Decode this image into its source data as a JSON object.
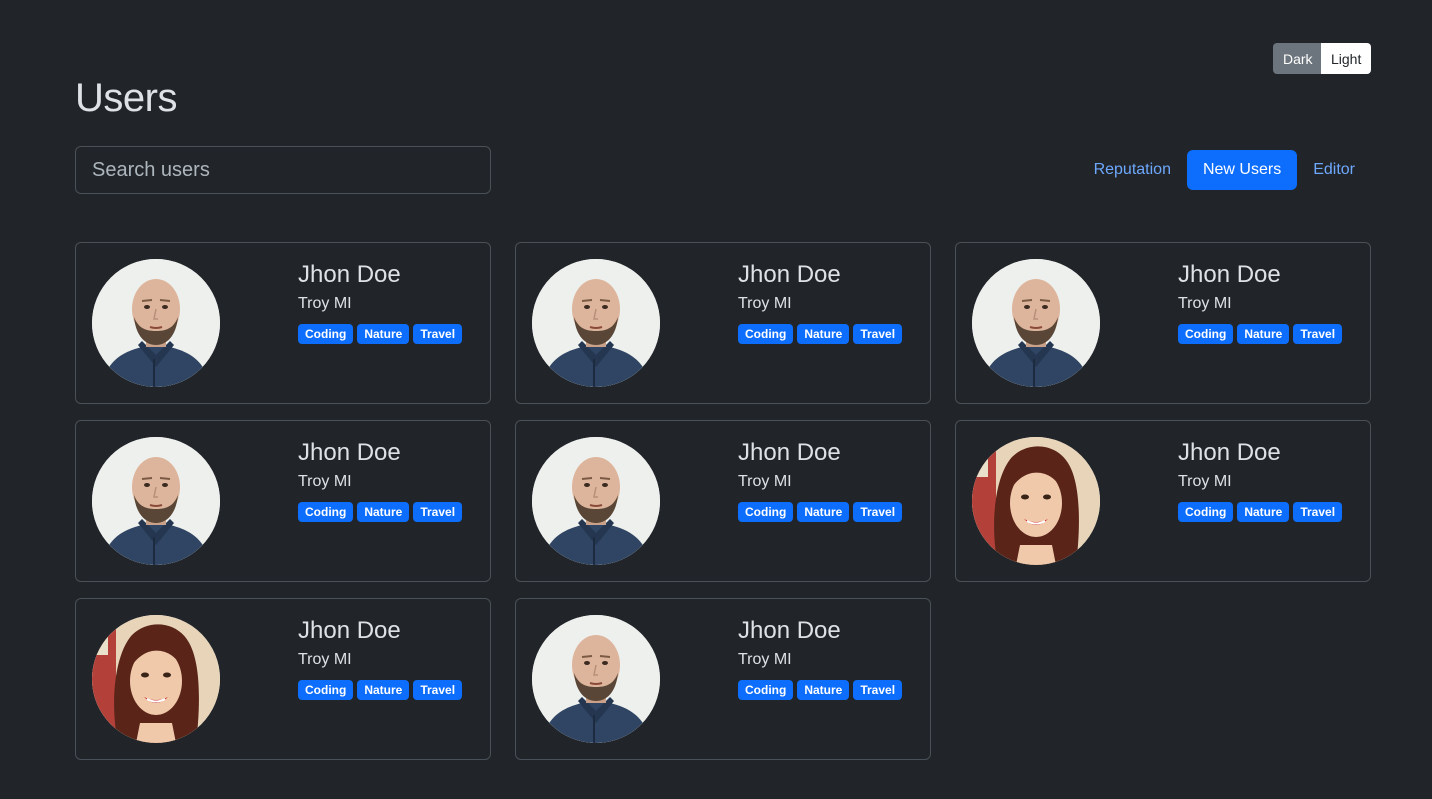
{
  "theme": {
    "dark_label": "Dark",
    "light_label": "Light",
    "selected": "Dark"
  },
  "page": {
    "title": "Users"
  },
  "search": {
    "placeholder": "Search users",
    "value": ""
  },
  "filters": {
    "tabs": [
      {
        "label": "Reputation",
        "active": false
      },
      {
        "label": "New Users",
        "active": true
      },
      {
        "label": "Editor",
        "active": false
      }
    ]
  },
  "users": [
    {
      "name": "Jhon Doe",
      "location": "Troy MI",
      "avatar": "man-avatar",
      "tags": [
        "Coding",
        "Nature",
        "Travel"
      ]
    },
    {
      "name": "Jhon Doe",
      "location": "Troy MI",
      "avatar": "man-avatar",
      "tags": [
        "Coding",
        "Nature",
        "Travel"
      ]
    },
    {
      "name": "Jhon Doe",
      "location": "Troy MI",
      "avatar": "man-avatar",
      "tags": [
        "Coding",
        "Nature",
        "Travel"
      ]
    },
    {
      "name": "Jhon Doe",
      "location": "Troy MI",
      "avatar": "man-avatar",
      "tags": [
        "Coding",
        "Nature",
        "Travel"
      ]
    },
    {
      "name": "Jhon Doe",
      "location": "Troy MI",
      "avatar": "man-avatar",
      "tags": [
        "Coding",
        "Nature",
        "Travel"
      ]
    },
    {
      "name": "Jhon Doe",
      "location": "Troy MI",
      "avatar": "woman-avatar",
      "tags": [
        "Coding",
        "Nature",
        "Travel"
      ]
    },
    {
      "name": "Jhon Doe",
      "location": "Troy MI",
      "avatar": "woman-avatar",
      "tags": [
        "Coding",
        "Nature",
        "Travel"
      ]
    },
    {
      "name": "Jhon Doe",
      "location": "Troy MI",
      "avatar": "man-avatar",
      "tags": [
        "Coding",
        "Nature",
        "Travel"
      ]
    }
  ],
  "colors": {
    "background": "#212529",
    "accent": "#0d6efd",
    "link": "#6ea8fe",
    "border": "#495057"
  }
}
